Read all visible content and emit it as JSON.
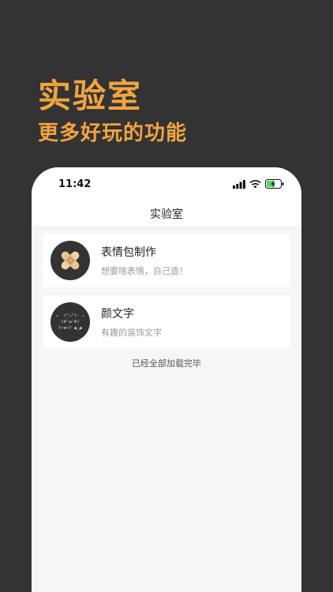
{
  "promo": {
    "title": "实验室",
    "subtitle": "更多好玩的功能",
    "accent_color": "#f0a440"
  },
  "status_bar": {
    "time": "11:42",
    "icons": [
      "cellular-signal-icon",
      "wifi-icon",
      "battery-charging-icon"
    ]
  },
  "nav": {
    "title": "实验室"
  },
  "items": [
    {
      "title": "表情包制作",
      "description": "想要啥表情，自己造！",
      "icon": "bandage-icon"
    },
    {
      "title": "颜文字",
      "description": "有趣的装饰文字",
      "icon": "kaomoji-icon",
      "icon_lines": [
        "ᴗ ·(°ᴗ°)· ᴗ",
        "(ฅ'ω'ฅ)",
        "ʕ•ᴥ•ʔ  ◕‿◕"
      ]
    }
  ],
  "footer": {
    "text": "已经全部加载完毕"
  }
}
